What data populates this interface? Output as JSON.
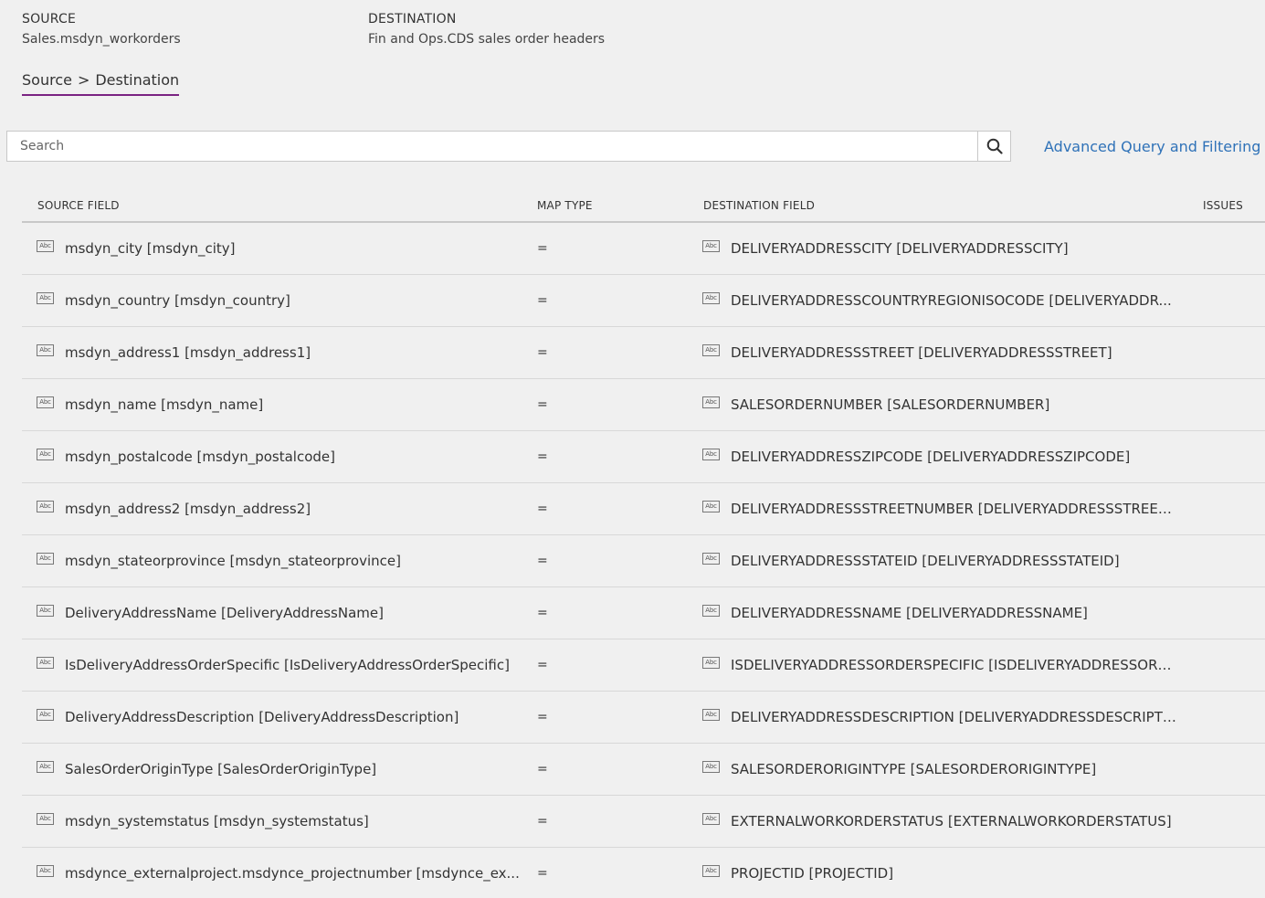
{
  "header": {
    "source_label": "SOURCE",
    "source_value": "Sales.msdyn_workorders",
    "destination_label": "DESTINATION",
    "destination_value": "Fin and Ops.CDS sales order headers"
  },
  "tab": {
    "source": "Source",
    "separator": ">",
    "destination": "Destination"
  },
  "search": {
    "placeholder": "Search"
  },
  "advanced_link": "Advanced Query and Filtering",
  "columns": {
    "source_field": "SOURCE FIELD",
    "map_type": "MAP TYPE",
    "destination_field": "DESTINATION FIELD",
    "issues": "ISSUES"
  },
  "type_icon_text": "Abc",
  "rows": [
    {
      "source": "msdyn_city [msdyn_city]",
      "map": "=",
      "destination": "DELIVERYADDRESSCITY [DELIVERYADDRESSCITY]"
    },
    {
      "source": "msdyn_country [msdyn_country]",
      "map": "=",
      "destination": "DELIVERYADDRESSCOUNTRYREGIONISOCODE [DELIVERYADDR..."
    },
    {
      "source": "msdyn_address1 [msdyn_address1]",
      "map": "=",
      "destination": "DELIVERYADDRESSSTREET [DELIVERYADDRESSSTREET]"
    },
    {
      "source": "msdyn_name [msdyn_name]",
      "map": "=",
      "destination": "SALESORDERNUMBER [SALESORDERNUMBER]"
    },
    {
      "source": "msdyn_postalcode [msdyn_postalcode]",
      "map": "=",
      "destination": "DELIVERYADDRESSZIPCODE [DELIVERYADDRESSZIPCODE]"
    },
    {
      "source": "msdyn_address2 [msdyn_address2]",
      "map": "=",
      "destination": "DELIVERYADDRESSSTREETNUMBER [DELIVERYADDRESSSTREET..."
    },
    {
      "source": "msdyn_stateorprovince [msdyn_stateorprovince]",
      "map": "=",
      "destination": "DELIVERYADDRESSSTATEID [DELIVERYADDRESSSTATEID]"
    },
    {
      "source": "DeliveryAddressName [DeliveryAddressName]",
      "map": "=",
      "destination": "DELIVERYADDRESSNAME [DELIVERYADDRESSNAME]"
    },
    {
      "source": "IsDeliveryAddressOrderSpecific [IsDeliveryAddressOrderSpecific]",
      "map": "=",
      "destination": "ISDELIVERYADDRESSORDERSPECIFIC [ISDELIVERYADDRESSORD..."
    },
    {
      "source": "DeliveryAddressDescription [DeliveryAddressDescription]",
      "map": "=",
      "destination": "DELIVERYADDRESSDESCRIPTION [DELIVERYADDRESSDESCRIPTI..."
    },
    {
      "source": "SalesOrderOriginType [SalesOrderOriginType]",
      "map": "=",
      "destination": "SALESORDERORIGINTYPE [SALESORDERORIGINTYPE]"
    },
    {
      "source": "msdyn_systemstatus [msdyn_systemstatus]",
      "map": "=",
      "destination": "EXTERNALWORKORDERSTATUS [EXTERNALWORKORDERSTATUS]"
    },
    {
      "source": "msdynce_externalproject.msdynce_projectnumber [msdynce_ex...",
      "map": "=",
      "destination": "PROJECTID [PROJECTID]"
    }
  ],
  "colors": {
    "accent_tab_underline": "#7a2382",
    "link": "#2f72b8",
    "background": "#f0f0f0"
  }
}
